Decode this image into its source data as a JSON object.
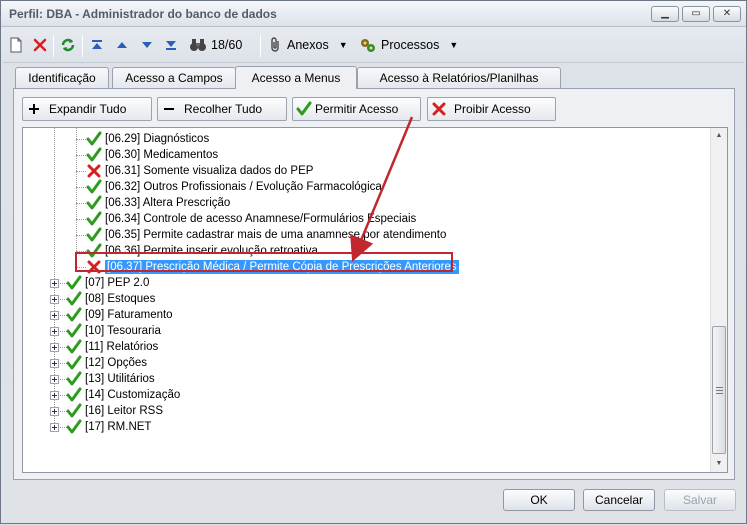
{
  "window": {
    "title": "Perfil: DBA - Administrador do banco de dados"
  },
  "toolbar": {
    "record_counter": "18/60",
    "anexos_label": "Anexos",
    "processos_label": "Processos"
  },
  "tabs": [
    {
      "label": "Identificação"
    },
    {
      "label": "Acesso a Campos"
    },
    {
      "label": "Acesso a Menus"
    },
    {
      "label": "Acesso à Relatórios/Planilhas"
    }
  ],
  "actions": {
    "expandir": "Expandir Tudo",
    "recolher": "Recolher Tudo",
    "permitir": "Permitir Acesso",
    "proibir": "Proibir Acesso"
  },
  "tree": {
    "children": [
      {
        "label": "[06.29] Diagnósticos",
        "access": "allowed"
      },
      {
        "label": "[06.30] Medicamentos",
        "access": "allowed"
      },
      {
        "label": "[06.31] Somente visualiza dados do PEP",
        "access": "denied"
      },
      {
        "label": "[06.32] Outros Profissionais / Evolução Farmacológica",
        "access": "allowed"
      },
      {
        "label": "[06.33] Altera Prescrição",
        "access": "allowed"
      },
      {
        "label": "[06.34] Controle de acesso Anamnese/Formulários Especiais",
        "access": "allowed"
      },
      {
        "label": "[06.35] Permite cadastrar mais de uma anamnese por atendimento",
        "access": "allowed"
      },
      {
        "label": "[06.36] Permite inserir evolução retroativa",
        "access": "allowed"
      },
      {
        "label": "[06.37] Prescrição Médica / Permite Cópia de Prescrições Anteriores",
        "access": "denied",
        "selected": true
      }
    ],
    "groups": [
      {
        "label": "[07] PEP 2.0",
        "access": "allowed"
      },
      {
        "label": "[08] Estoques",
        "access": "allowed"
      },
      {
        "label": "[09] Faturamento",
        "access": "allowed"
      },
      {
        "label": "[10] Tesouraria",
        "access": "allowed"
      },
      {
        "label": "[11] Relatórios",
        "access": "allowed"
      },
      {
        "label": "[12] Opções",
        "access": "allowed"
      },
      {
        "label": "[13] Utilitários",
        "access": "allowed"
      },
      {
        "label": "[14] Customização",
        "access": "allowed"
      },
      {
        "label": "[16] Leitor RSS",
        "access": "allowed"
      },
      {
        "label": "[17] RM.NET",
        "access": "allowed"
      }
    ]
  },
  "footer": {
    "ok": "OK",
    "cancel": "Cancelar",
    "save": "Salvar"
  },
  "colors": {
    "allowed": "#2e9b1f",
    "denied": "#d81e1e",
    "highlight": "#c0282d",
    "selection": "#3399ff"
  }
}
